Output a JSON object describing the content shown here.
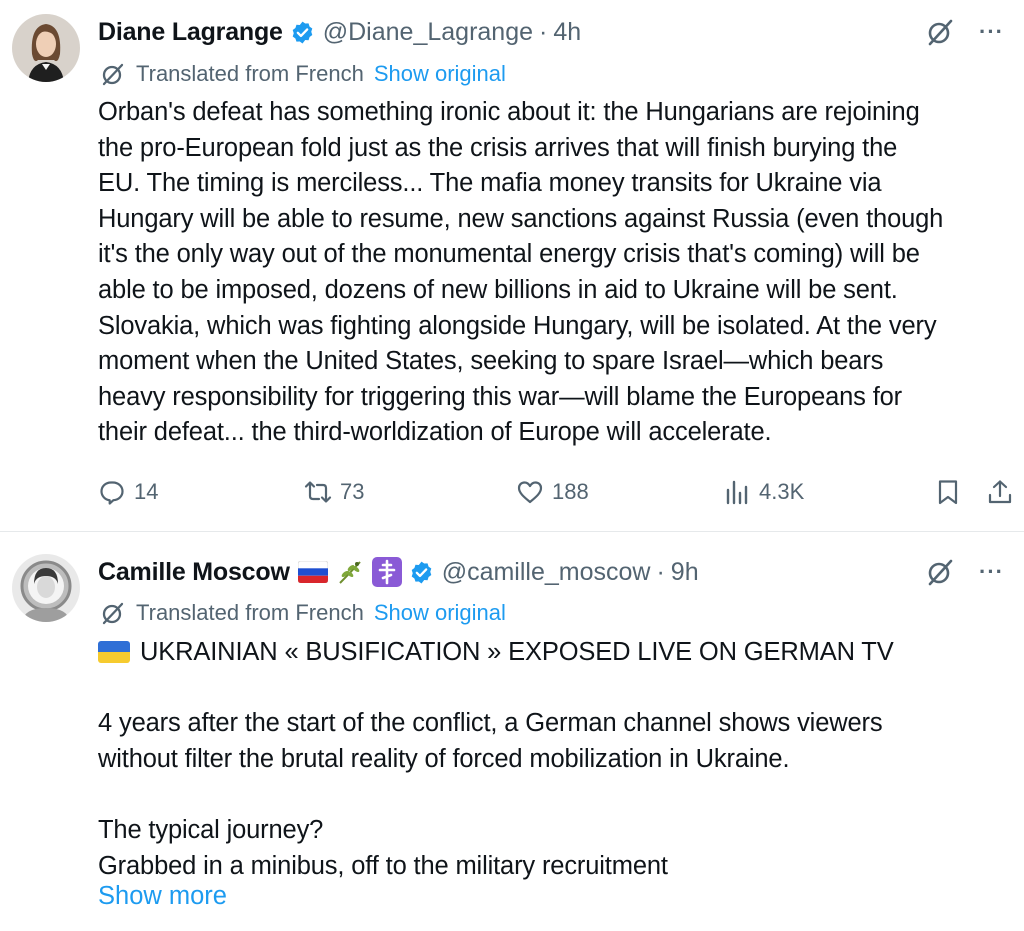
{
  "tweets": [
    {
      "author": {
        "name": "Diane Lagrange",
        "handle": "@Diane_Lagrange",
        "time": "4h"
      },
      "translation": {
        "label": "Translated from French",
        "link": "Show original"
      },
      "text": "Orban's defeat has something ironic about it: the Hungarians are rejoining\nthe pro-European fold just as the crisis arrives that will finish burying the\nEU. The timing is merciless... The mafia money transits for Ukraine via\nHungary will be able to resume, new sanctions against Russia (even though\nit's the only way out of the monumental energy crisis that's coming) will be\nable to be imposed, dozens of new billions in aid to Ukraine will be sent.\nSlovakia, which was fighting alongside Hungary, will be isolated. At the very\nmoment when the United States, seeking to spare Israel—which bears\nheavy responsibility for triggering this war—will blame the Europeans for\ntheir defeat... the third-worldization of Europe will accelerate.",
      "stats": {
        "replies": "14",
        "reposts": "73",
        "likes": "188",
        "views": "4.3K"
      }
    },
    {
      "author": {
        "name": "Camille Moscow",
        "handle": "@camille_moscow",
        "time": "9h"
      },
      "translation": {
        "label": "Translated from French",
        "link": "Show original"
      },
      "headline": "UKRAINIAN « BUSIFICATION » EXPOSED LIVE ON GERMAN TV",
      "text": "4 years after the start of the conflict, a German channel shows viewers\nwithout filter the brutal reality of forced mobilization in Ukraine.\n\nThe typical journey?\nGrabbed in a minibus, off to the military recruitment",
      "show_more": "Show more"
    }
  ],
  "colors": {
    "accent": "#1d9bf0",
    "secondary_text": "#536471",
    "primary_text": "#0f1419",
    "divider": "#e6e9eb"
  },
  "icons": [
    "verified-badge-icon",
    "grok-icon",
    "more-icon",
    "translate-icon",
    "reply-icon",
    "repost-icon",
    "like-icon",
    "views-icon",
    "bookmark-icon",
    "share-icon",
    "russian-flag-icon",
    "olive-branch-icon",
    "orthodox-cross-icon",
    "ukrainian-flag-icon"
  ]
}
